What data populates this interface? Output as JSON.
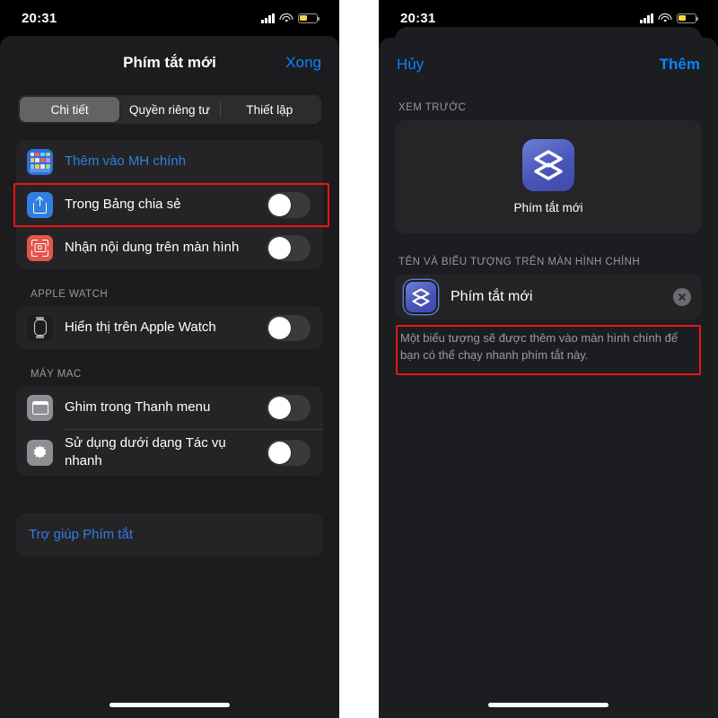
{
  "status_bar": {
    "time": "20:31",
    "battery_level_pct": 42,
    "battery_color": "#f3d648"
  },
  "left_screen": {
    "nav": {
      "title": "Phím tắt mới",
      "done_label": "Xong"
    },
    "segments": [
      {
        "label": "Chi tiết",
        "active": true
      },
      {
        "label": "Quyền riêng tư",
        "active": false
      },
      {
        "label": "Thiết lập",
        "active": false
      }
    ],
    "groups": [
      {
        "header": "",
        "rows": [
          {
            "label": "Thêm vào MH chính",
            "icon": "home-screen-icon",
            "style": "link",
            "control": "none",
            "highlighted": true
          },
          {
            "label": "Trong Bảng chia sẻ",
            "icon": "share-sheet-icon",
            "style": "normal",
            "control": "toggle",
            "toggle_on": false
          },
          {
            "label": "Nhận nội dung trên màn hình",
            "icon": "screen-content-icon",
            "style": "normal",
            "control": "toggle",
            "toggle_on": false
          }
        ]
      },
      {
        "header": "APPLE WATCH",
        "rows": [
          {
            "label": "Hiển thị trên Apple Watch",
            "icon": "apple-watch-icon",
            "style": "normal",
            "control": "toggle",
            "toggle_on": false
          }
        ]
      },
      {
        "header": "MÁY MAC",
        "rows": [
          {
            "label": "Ghim trong Thanh menu",
            "icon": "menu-bar-icon",
            "style": "normal",
            "control": "toggle",
            "toggle_on": false
          },
          {
            "label": "Sử dụng dưới dạng Tác vụ nhanh",
            "icon": "gear-icon",
            "style": "normal",
            "control": "toggle",
            "toggle_on": false
          }
        ]
      }
    ],
    "help_row": {
      "label": "Trợ giúp Phím tắt"
    }
  },
  "right_screen": {
    "nav": {
      "cancel_label": "Hủy",
      "add_label": "Thêm"
    },
    "preview_section": {
      "header": "XEM TRƯỚC",
      "icon": "shortcuts-app-icon",
      "name": "Phím tắt mới"
    },
    "name_section": {
      "header": "TÊN VÀ BIỂU TƯỢNG TRÊN MÀN HÌNH CHÍNH",
      "icon": "shortcuts-app-icon",
      "value": "Phím tắt mới",
      "clear_icon": "clear-circle-icon",
      "highlighted": true,
      "footnote": "Một biểu tượng sẽ được thêm vào màn hình chính để bạn có thể chạy nhanh phím tắt này."
    }
  },
  "colors": {
    "accent_blue": "#0a84ff",
    "link_blue": "#2f7fe0",
    "highlight_red": "#f01414",
    "sheet_bg": "#1c1c1e",
    "group_bg": "#242426"
  }
}
